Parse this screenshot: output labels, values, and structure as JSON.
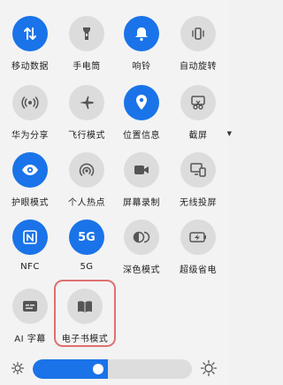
{
  "tiles": [
    {
      "label": "移动数据",
      "icon": "mobile-data-icon",
      "active": true
    },
    {
      "label": "手电筒",
      "icon": "flashlight-icon",
      "active": false
    },
    {
      "label": "响铃",
      "icon": "bell-icon",
      "active": true
    },
    {
      "label": "自动旋转",
      "icon": "auto-rotate-icon",
      "active": false
    },
    {
      "label": "华为分享",
      "icon": "huawei-share-icon",
      "active": false
    },
    {
      "label": "飞行模式",
      "icon": "airplane-icon",
      "active": false
    },
    {
      "label": "位置信息",
      "icon": "location-icon",
      "active": true
    },
    {
      "label": "截屏",
      "icon": "screenshot-icon",
      "active": false
    },
    {
      "label": "护眼模式",
      "icon": "eye-comfort-icon",
      "active": true
    },
    {
      "label": "个人热点",
      "icon": "hotspot-icon",
      "active": false
    },
    {
      "label": "屏幕录制",
      "icon": "screen-record-icon",
      "active": false
    },
    {
      "label": "无线投屏",
      "icon": "wireless-projection-icon",
      "active": false
    },
    {
      "label": "NFC",
      "icon": "nfc-icon",
      "active": true
    },
    {
      "label": "5G",
      "icon": "5g-icon",
      "active": true
    },
    {
      "label": "深色模式",
      "icon": "dark-mode-icon",
      "active": false
    },
    {
      "label": "超级省电",
      "icon": "power-saving-icon",
      "active": false
    },
    {
      "label": "AI 字幕",
      "icon": "ai-subtitle-icon",
      "active": false
    },
    {
      "label": "电子书模式",
      "icon": "ebook-icon",
      "active": false
    }
  ],
  "five_g_text": "5G",
  "brightness": {
    "level": 0.47
  },
  "colors": {
    "accent": "#1a73e8",
    "inactive": "#dcdcdc",
    "highlight": "#e07070"
  }
}
